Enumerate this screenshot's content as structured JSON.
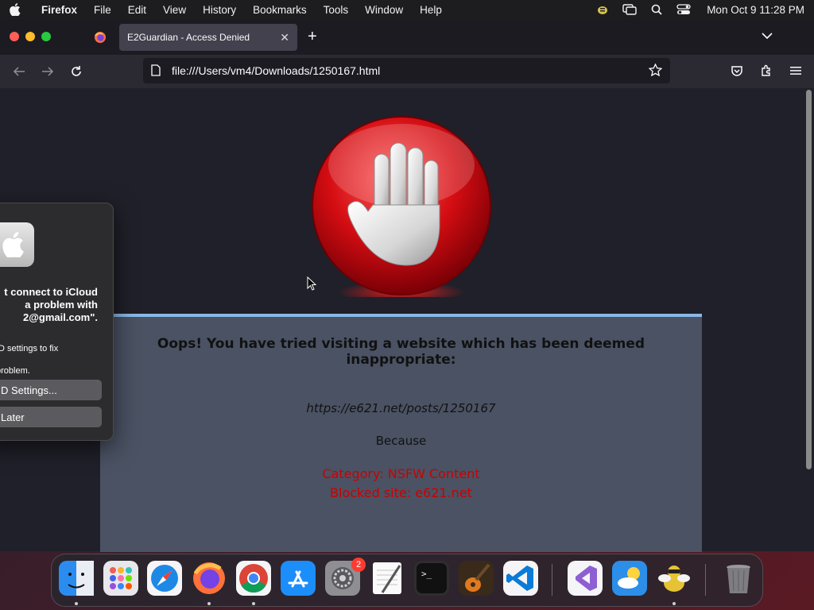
{
  "menubar": {
    "app": "Firefox",
    "items": [
      "File",
      "Edit",
      "View",
      "History",
      "Bookmarks",
      "Tools",
      "Window",
      "Help"
    ],
    "clock": "Mon Oct 9  11:28 PM"
  },
  "browser": {
    "tab_title": "E2Guardian - Access Denied",
    "url": "file:///Users/vm4/Downloads/1250167.html"
  },
  "page": {
    "headline": "Oops! You have tried visiting a website which has been deemed inappropriate:",
    "blocked_url": "https://e621.net/posts/1250167",
    "because": "Because",
    "category": "Category: NSFW Content",
    "blocked_site": "Blocked site: e621.net"
  },
  "alert": {
    "message": "t connect to iCloud\na problem with\n2@gmail.com\".",
    "sub_line1": "ID settings to fix",
    "sub_line2": "problem.",
    "settings_button": "D Settings...",
    "later_button": "Later"
  },
  "dock": {
    "settings_badge": "2",
    "apps": [
      "finder-icon",
      "launchpad-icon",
      "safari-icon",
      "firefox-icon",
      "chrome-icon",
      "app-store-icon",
      "system-settings-icon",
      "textedit-icon",
      "terminal-icon",
      "garageband-icon",
      "vscode-icon",
      "visual-studio-icon",
      "weather-icon",
      "cyberduck-icon",
      "trash-icon"
    ]
  }
}
